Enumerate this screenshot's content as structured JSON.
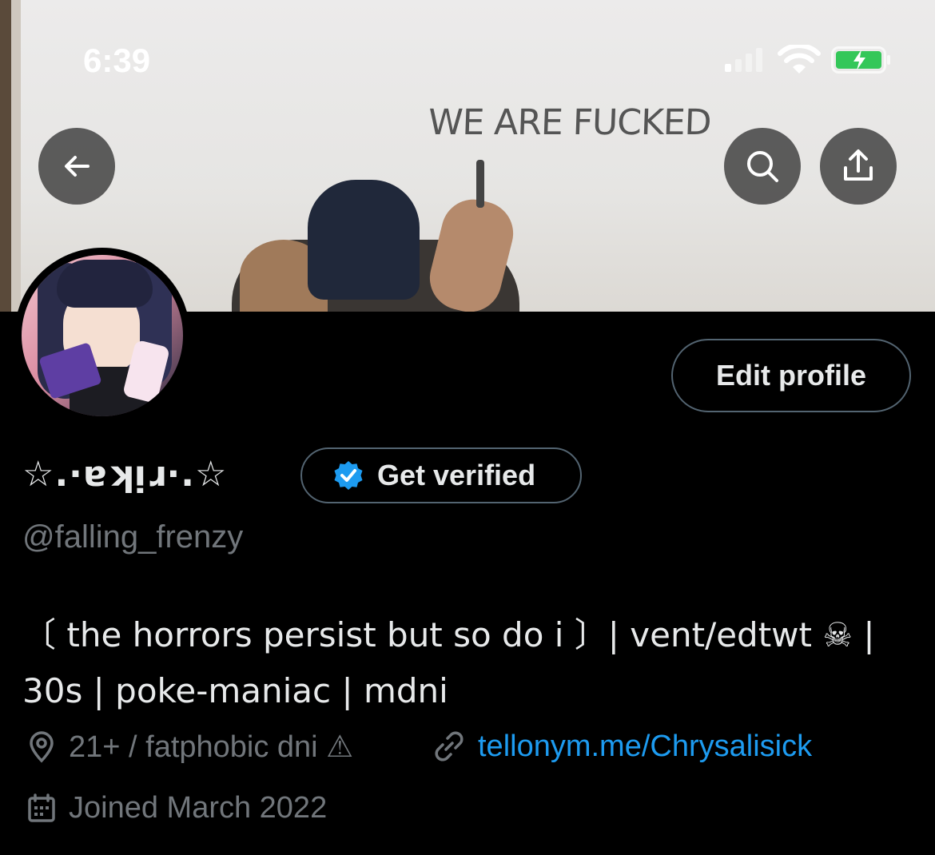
{
  "status_bar": {
    "time": "6:39"
  },
  "banner": {
    "sign_text": "WE ARE FUCKED"
  },
  "header": {
    "back_icon": "arrow-left-icon",
    "search_icon": "search-icon",
    "share_icon": "share-icon"
  },
  "profile": {
    "edit_label": "Edit profile",
    "display_name": "☆.·ɐʞᴉɹ·.☆",
    "verify_label": "Get verified",
    "handle": "@falling_frenzy",
    "bio_line1": "〔 the horrors persist but so do i 〕| vent/edtwt ☠ |",
    "bio_line2": "30s | poke-maniac | mdni",
    "location": "21+ / fatphobic dni ⚠",
    "website": "tellonym.me/Chrysalisick",
    "joined": "Joined March 2022"
  },
  "colors": {
    "accent": "#1d9bf0",
    "muted": "#71767b",
    "text": "#e7e9ea",
    "border": "#536471"
  }
}
